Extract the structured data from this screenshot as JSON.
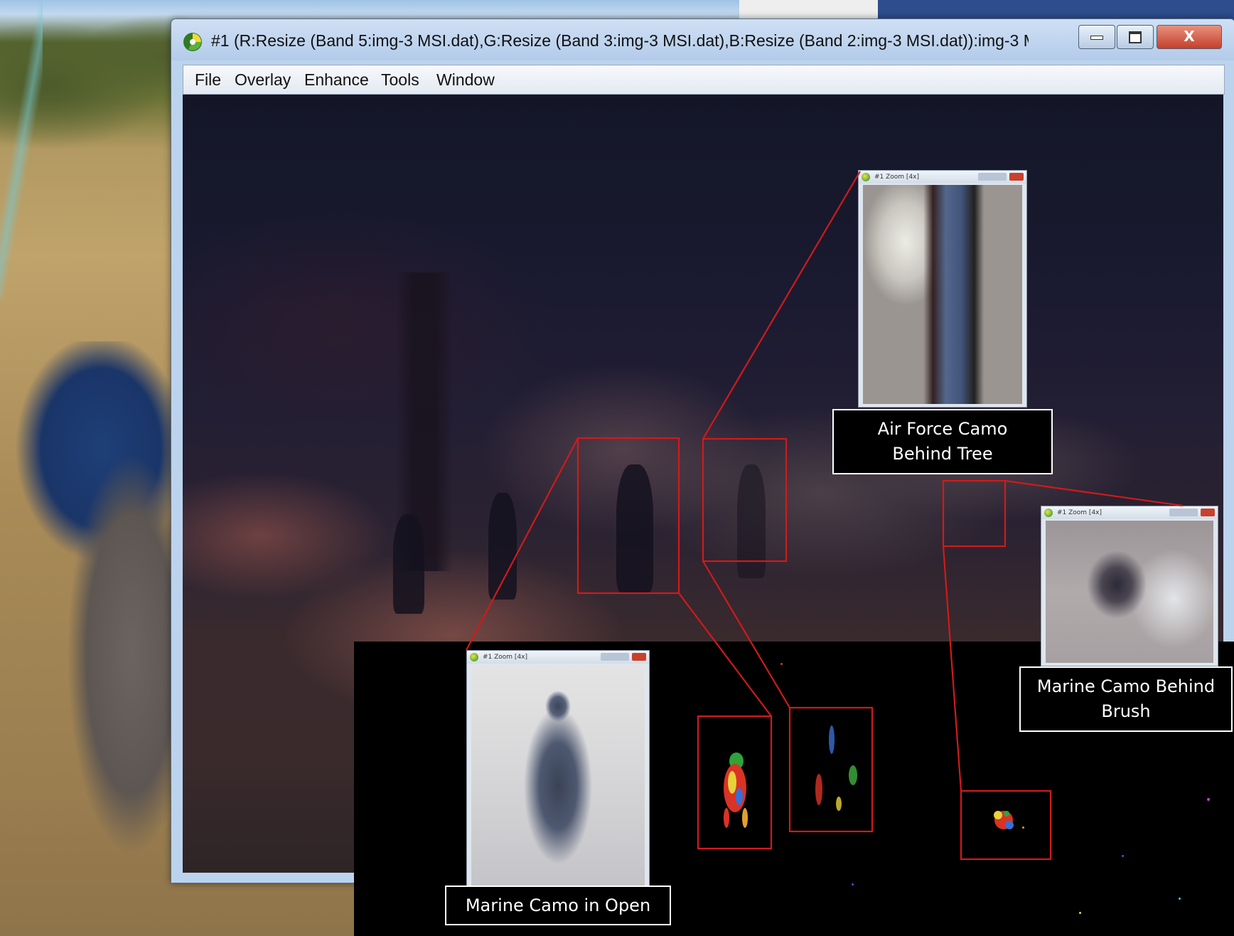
{
  "window": {
    "title": "#1 (R:Resize (Band 5:img-3 MSI.dat),G:Resize (Band 3:img-3 MSI.dat),B:Resize (Band 2:img-3 MSI.dat)):img-3 M...",
    "minimize_icon": "minimize-icon",
    "maximize_icon": "maximize-icon",
    "close_icon": "close-icon",
    "close_glyph": "X"
  },
  "menu": {
    "items": [
      "File",
      "Overlay",
      "Enhance",
      "Tools",
      "Window"
    ]
  },
  "zoom_windows": {
    "air_force": {
      "title": "#1 Zoom [4x]"
    },
    "marine_brush": {
      "title": "#1 Zoom [4x]"
    },
    "marine_open": {
      "title": "#1 Zoom [4x]"
    }
  },
  "captions": {
    "air_force": "Air Force Camo\nBehind Tree",
    "marine_brush": "Marine Camo Behind\nBrush",
    "marine_open": "Marine Camo in Open"
  },
  "colors": {
    "highlight_box": "#d11a1a",
    "caption_bg": "#000000",
    "caption_text": "#ffffff"
  }
}
